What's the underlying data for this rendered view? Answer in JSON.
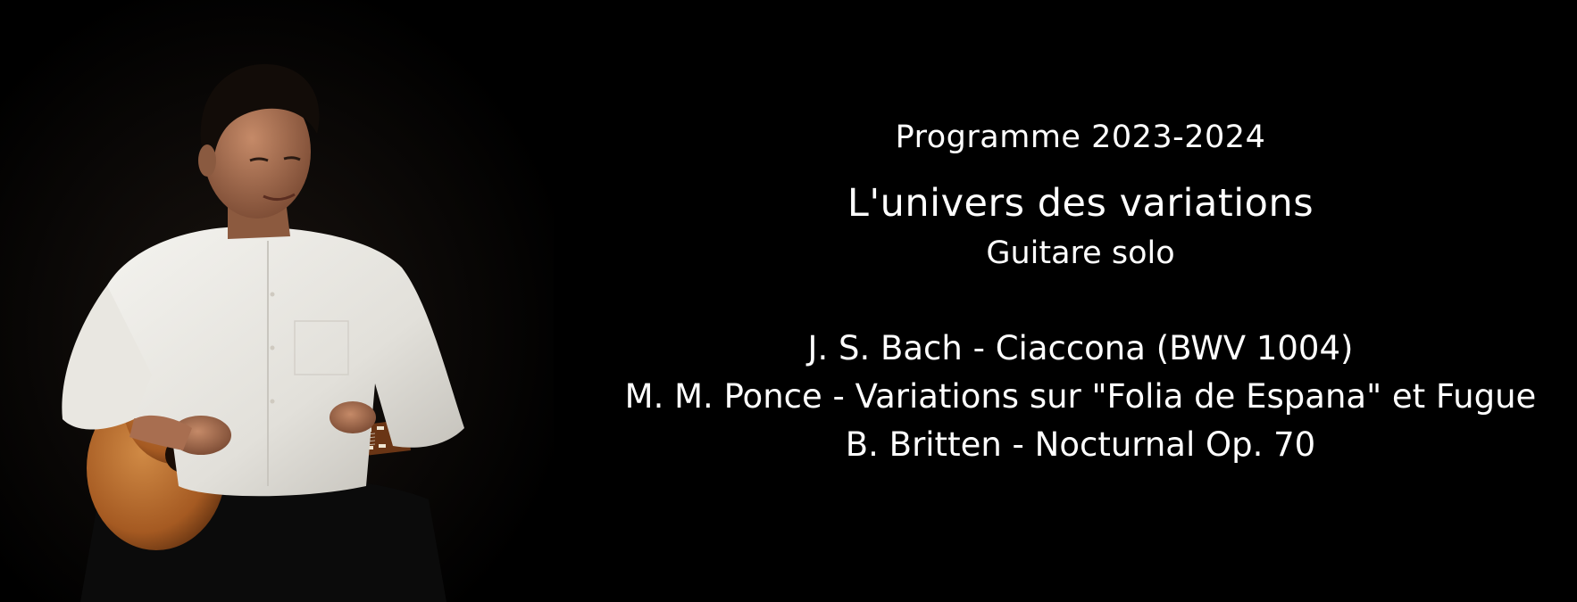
{
  "programme": {
    "season": "Programme 2023-2024",
    "title": "L'univers des variations",
    "subtitle": "Guitare solo",
    "works": [
      "J. S. Bach - Ciaccona (BWV 1004)",
      "M. M. Ponce - Variations sur \"Folia de Espana\" et Fugue",
      "B. Britten - Nocturnal Op. 70"
    ]
  },
  "colors": {
    "background": "#000000",
    "text": "#ffffff",
    "shirt": "#ecebe6",
    "guitar_body": "#b8682c",
    "skin": "#b07656"
  }
}
